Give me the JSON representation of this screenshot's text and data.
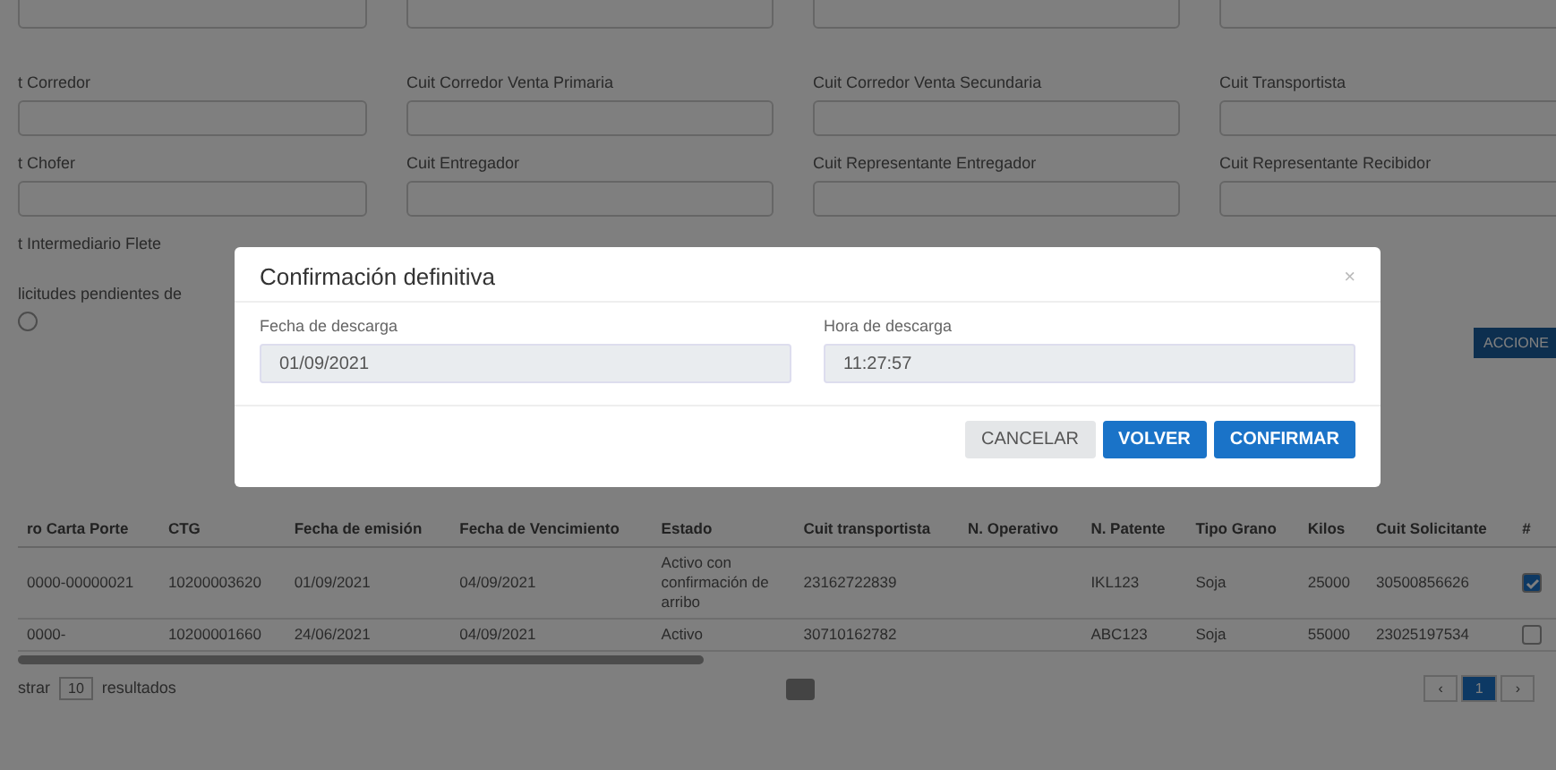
{
  "form": {
    "fields": [
      {
        "label": "t Corredor"
      },
      {
        "label": "Cuit Corredor Venta Primaria"
      },
      {
        "label": "Cuit Corredor Venta Secundaria"
      },
      {
        "label": "Cuit Transportista"
      },
      {
        "label": "t Chofer"
      },
      {
        "label": "Cuit Entregador"
      },
      {
        "label": "Cuit Representante Entregador"
      },
      {
        "label": "Cuit Representante Recibidor"
      },
      {
        "label": "t Intermediario Flete"
      }
    ]
  },
  "pending": {
    "label": "licitudes pendientes de",
    "checked": false
  },
  "actions_button": "ACCIONE",
  "table": {
    "columns": [
      "ro Carta Porte",
      "CTG",
      "Fecha de emisión",
      "Fecha de Vencimiento",
      "Estado",
      "Cuit transportista",
      "N. Operativo",
      "N. Patente",
      "Tipo Grano",
      "Kilos",
      "Cuit Solicitante",
      "#"
    ],
    "rows": [
      {
        "cells": [
          "0000-00000021",
          "10200003620",
          "01/09/2021",
          "04/09/2021",
          "Activo con confirmación de arribo",
          "23162722839",
          "",
          "IKL123",
          "Soja",
          "25000",
          "30500856626"
        ],
        "checked": true
      },
      {
        "cells": [
          "0000-",
          "10200001660",
          "24/06/2021",
          "04/09/2021",
          "Activo",
          "30710162782",
          "",
          "ABC123",
          "Soja",
          "55000",
          "23025197534"
        ],
        "checked": false
      }
    ]
  },
  "footer": {
    "show_label": "strar",
    "page_size": "10",
    "results_label": "resultados",
    "pages": [
      {
        "label": "‹",
        "selected": false
      },
      {
        "label": "1",
        "selected": true
      },
      {
        "label": "›",
        "selected": false
      }
    ]
  },
  "modal": {
    "title": "Confirmación definitiva",
    "close": "×",
    "fields": [
      {
        "label": "Fecha de descarga",
        "value": "01/09/2021"
      },
      {
        "label": "Hora de descarga",
        "value": "11:27:57"
      }
    ],
    "buttons": [
      {
        "label": "CANCELAR",
        "kind": "secondary"
      },
      {
        "label": "VOLVER",
        "kind": "primary"
      },
      {
        "label": "CONFIRMAR",
        "kind": "primary"
      }
    ]
  }
}
